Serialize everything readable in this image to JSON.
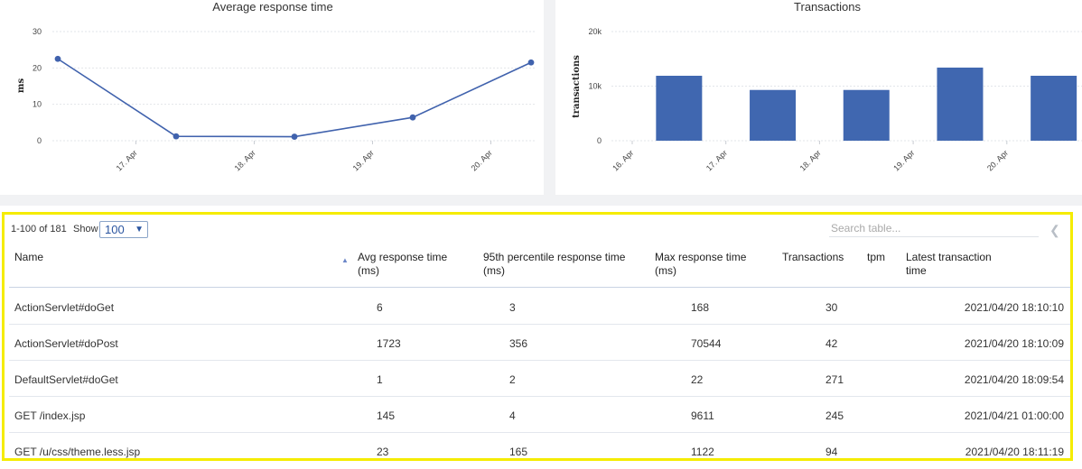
{
  "charts": [
    {
      "id": "avg-response",
      "chart_data": {
        "type": "line",
        "title": "Average response time",
        "ylabel": "ms",
        "ylim": [
          0,
          30
        ],
        "yticks": [
          "0",
          "10",
          "20",
          "30"
        ],
        "xticks": [
          "17. Apr",
          "18. Apr",
          "19. Apr",
          "20. Apr"
        ],
        "series": [
          {
            "x": [
              "2021-04-16",
              "2021-04-17",
              "2021-04-18",
              "2021-04-19",
              "2021-04-20"
            ],
            "values": [
              22.5,
              1.2,
              1.1,
              6.4,
              21.5
            ]
          }
        ],
        "color": "#4062ad"
      }
    },
    {
      "id": "transactions",
      "chart_data": {
        "type": "bar",
        "title": "Transactions",
        "ylabel": "transactions",
        "ylim": [
          0,
          20000
        ],
        "yticks": [
          "0",
          "10k",
          "20k"
        ],
        "xticks": [
          "16. Apr",
          "17. Apr",
          "18. Apr",
          "19. Apr",
          "20. Apr"
        ],
        "categories": [
          "2021-04-16",
          "2021-04-17",
          "2021-04-18",
          "2021-04-19",
          "2021-04-20"
        ],
        "values": [
          11900,
          9300,
          9300,
          13400,
          11900
        ],
        "color": "#4067b0"
      }
    }
  ],
  "table": {
    "pager_info": "1-100 of 181",
    "show_label": "Show",
    "show_value": "100",
    "search_placeholder": "Search table...",
    "collapse_icon": "chevron-left-icon",
    "sort_icon": "sort-asc-icon",
    "columns": [
      "Name",
      "Avg response time (ms)",
      "95th percentile response time (ms)",
      "Max response time (ms)",
      "Transactions",
      "tpm",
      "Latest transaction time"
    ],
    "rows": [
      {
        "name": "ActionServlet#doGet",
        "avg": "6",
        "p95": "3",
        "max": "168",
        "tx": "30",
        "latest": "2021/04/20 18:10:10"
      },
      {
        "name": "ActionServlet#doPost",
        "avg": "1723",
        "p95": "356",
        "max": "70544",
        "tx": "42",
        "latest": "2021/04/20 18:10:09"
      },
      {
        "name": "DefaultServlet#doGet",
        "avg": "1",
        "p95": "2",
        "max": "22",
        "tx": "271",
        "latest": "2021/04/20 18:09:54"
      },
      {
        "name": "GET /index.jsp",
        "avg": "145",
        "p95": "4",
        "max": "9611",
        "tx": "245",
        "latest": "2021/04/21 01:00:00"
      },
      {
        "name": "GET /u/css/theme.less.jsp",
        "avg": "23",
        "p95": "165",
        "max": "1122",
        "tx": "94",
        "latest": "2021/04/20 18:11:19"
      }
    ]
  },
  "colors": {
    "highlight": "#f5ec00",
    "accent": "#4062ad"
  }
}
